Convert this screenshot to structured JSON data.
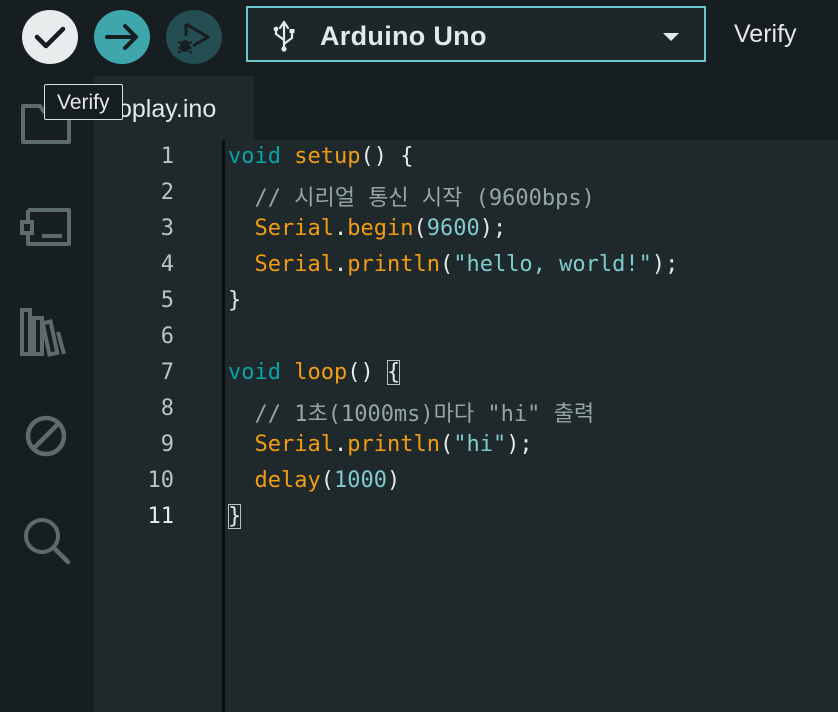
{
  "toolbar": {
    "verify_icon": "checkmark-icon",
    "upload_icon": "arrow-right-icon",
    "debug_icon": "debug-play-icon",
    "board": {
      "icon": "usb-icon",
      "name": "Arduino Uno",
      "caret_icon": "caret-down-icon"
    },
    "right_label": "Verify"
  },
  "tooltip": {
    "text": "Verify"
  },
  "sidebar": {
    "items": [
      {
        "name": "folder-icon"
      },
      {
        "name": "board-manager-icon"
      },
      {
        "name": "library-icon"
      },
      {
        "name": "debug-icon"
      },
      {
        "name": "search-icon"
      }
    ]
  },
  "tabs": [
    {
      "label": "oplay.ino",
      "active": true
    }
  ],
  "editor": {
    "active_line": 11,
    "lines": [
      {
        "n": "1",
        "tokens": [
          [
            "kw",
            "void"
          ],
          [
            "pl",
            " "
          ],
          [
            "fn",
            "setup"
          ],
          [
            "pl",
            "() {"
          ]
        ]
      },
      {
        "n": "2",
        "tokens": [
          [
            "cmt",
            "  // 시리얼 통신 시작 (9600bps)"
          ]
        ]
      },
      {
        "n": "3",
        "tokens": [
          [
            "pl",
            "  "
          ],
          [
            "fn",
            "Serial"
          ],
          [
            "pl",
            "."
          ],
          [
            "fn",
            "begin"
          ],
          [
            "pl",
            "("
          ],
          [
            "num",
            "9600"
          ],
          [
            "pl",
            ");"
          ]
        ]
      },
      {
        "n": "4",
        "tokens": [
          [
            "pl",
            "  "
          ],
          [
            "fn",
            "Serial"
          ],
          [
            "pl",
            "."
          ],
          [
            "fn",
            "println"
          ],
          [
            "pl",
            "("
          ],
          [
            "str",
            "\"hello, world!\""
          ],
          [
            "pl",
            ");"
          ]
        ]
      },
      {
        "n": "5",
        "tokens": [
          [
            "pl",
            "}"
          ]
        ]
      },
      {
        "n": "6",
        "tokens": []
      },
      {
        "n": "7",
        "tokens": [
          [
            "kw",
            "void"
          ],
          [
            "pl",
            " "
          ],
          [
            "fn",
            "loop"
          ],
          [
            "pl",
            "() "
          ],
          [
            "box",
            "{"
          ]
        ]
      },
      {
        "n": "8",
        "tokens": [
          [
            "cmt",
            "  // 1초(1000ms)마다 \"hi\" 출력"
          ]
        ]
      },
      {
        "n": "9",
        "tokens": [
          [
            "pl",
            "  "
          ],
          [
            "fn",
            "Serial"
          ],
          [
            "pl",
            "."
          ],
          [
            "fn",
            "println"
          ],
          [
            "pl",
            "("
          ],
          [
            "str",
            "\"hi\""
          ],
          [
            "pl",
            ");"
          ]
        ]
      },
      {
        "n": "10",
        "tokens": [
          [
            "pl",
            "  "
          ],
          [
            "fn",
            "delay"
          ],
          [
            "pl",
            "("
          ],
          [
            "num",
            "1000"
          ],
          [
            "pl",
            ")"
          ]
        ]
      },
      {
        "n": "11",
        "tokens": [
          [
            "box",
            "}"
          ]
        ]
      }
    ]
  },
  "colors": {
    "background": "#171e21",
    "editor_bg": "#1f292c",
    "keyword": "#0ca1a6",
    "function": "#f39c12",
    "number": "#7fcbcd",
    "comment": "#95a5a6",
    "accent_border": "#6fc6c9"
  }
}
